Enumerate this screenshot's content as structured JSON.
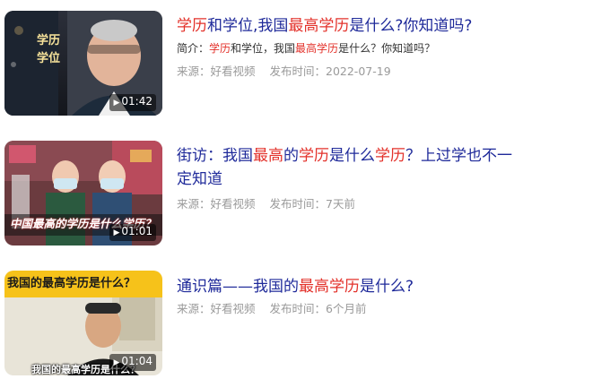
{
  "results": [
    {
      "title_parts": [
        {
          "t": "学历",
          "hl": true
        },
        {
          "t": "和学位,我国",
          "hl": false
        },
        {
          "t": "最高学历",
          "hl": true
        },
        {
          "t": "是什么?你知道吗?",
          "hl": false
        }
      ],
      "desc_parts": [
        {
          "t": "简介：",
          "hl": false
        },
        {
          "t": "学历",
          "hl": true
        },
        {
          "t": "和学位，我国",
          "hl": false
        },
        {
          "t": "最高学历",
          "hl": true
        },
        {
          "t": "是什么？你知道吗？",
          "hl": false
        }
      ],
      "source": "来源：好看视频",
      "time": "发布时间：2022-07-19",
      "duration": "01:42",
      "thumb_caption": "学历\n学位"
    },
    {
      "title_parts": [
        {
          "t": "街访：我国",
          "hl": false
        },
        {
          "t": "最高",
          "hl": true
        },
        {
          "t": "的",
          "hl": false
        },
        {
          "t": "学历",
          "hl": true
        },
        {
          "t": "是什么",
          "hl": false
        },
        {
          "t": "学历",
          "hl": true
        },
        {
          "t": "？上过学也不一定知道",
          "hl": false
        }
      ],
      "desc_parts": [],
      "source": "来源：好看视频",
      "time": "发布时间：7天前",
      "duration": "01:01",
      "thumb_caption": "中国最高的学历是什么学历？"
    },
    {
      "title_parts": [
        {
          "t": "通识篇——我国的",
          "hl": false
        },
        {
          "t": "最高学历",
          "hl": true
        },
        {
          "t": "是什么?",
          "hl": false
        }
      ],
      "desc_parts": [],
      "source": "来源：好看视频",
      "time": "发布时间：6个月前",
      "duration": "01:04",
      "thumb_caption": "我国的最高学历是什么？",
      "thumb_subtitle": "我国的最高学历是什么？"
    }
  ],
  "icons": {
    "play": "play-icon"
  },
  "colors": {
    "title": "#1f2a9a",
    "highlight": "#e3322b",
    "meta": "#9a9a9a"
  }
}
